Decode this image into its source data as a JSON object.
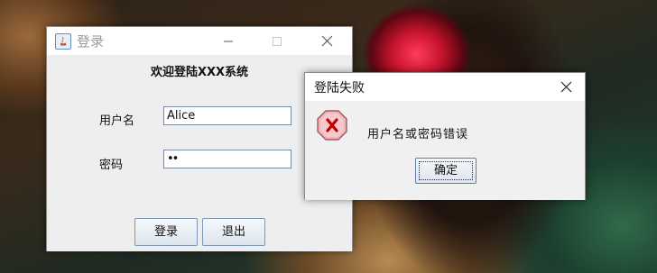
{
  "login_window": {
    "title": "登录",
    "welcome": "欢迎登陆XXX系统",
    "username_label": "用户名",
    "username_value": "Alice",
    "password_label": "密码",
    "password_value": "••",
    "login_button": "登录",
    "exit_button": "退出",
    "minimize_glyph": "—",
    "close_glyph": "✕"
  },
  "error_dialog": {
    "title": "登陆失败",
    "message": "用户名或密码错误",
    "ok_button": "确定",
    "icon": "error-x-icon",
    "close_glyph": "✕"
  },
  "colors": {
    "error_icon_fill": "#f2b3b8",
    "error_icon_x": "#c00000",
    "button_border": "#7e97b8"
  }
}
